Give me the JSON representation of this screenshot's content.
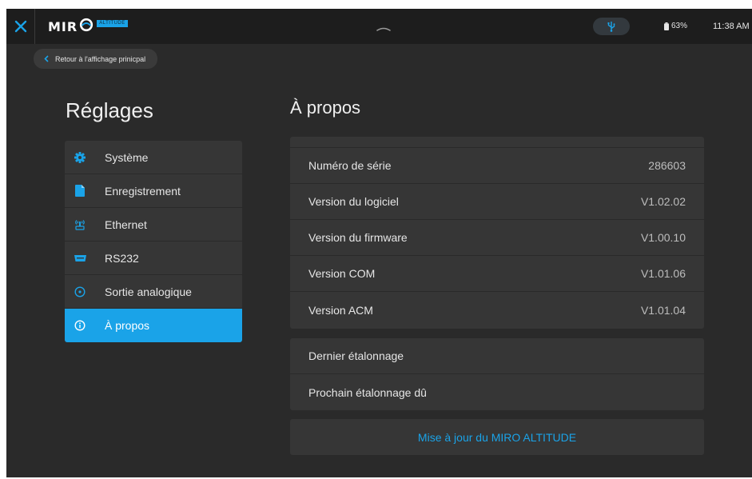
{
  "topbar": {
    "logo_text": "MIR",
    "logo_badge": "ALTITUDE",
    "battery": "63%",
    "time": "11:38 AM"
  },
  "back": {
    "label": "Retour à l'affichage prinicpal"
  },
  "sidebar": {
    "title": "Réglages",
    "items": [
      {
        "label": "Système",
        "icon": "gear-icon"
      },
      {
        "label": "Enregistrement",
        "icon": "file-icon"
      },
      {
        "label": "Ethernet",
        "icon": "ethernet-icon"
      },
      {
        "label": "RS232",
        "icon": "serial-port-icon"
      },
      {
        "label": "Sortie analogique",
        "icon": "analog-output-icon"
      },
      {
        "label": "À propos",
        "icon": "info-icon",
        "active": true
      }
    ]
  },
  "main": {
    "title": "À propos",
    "info_rows": [
      {
        "label": "Numéro de série",
        "value": "286603"
      },
      {
        "label": "Version du logiciel",
        "value": "V1.02.02"
      },
      {
        "label": "Version du firmware",
        "value": "V1.00.10"
      },
      {
        "label": "Version COM",
        "value": "V1.01.06"
      },
      {
        "label": "Version ACM",
        "value": "V1.01.04"
      }
    ],
    "calibration": {
      "last_label": "Dernier étalonnage",
      "next_label": "Prochain étalonnage dû"
    },
    "update_button": "Mise à jour du MIRO ALTITUDE"
  },
  "colors": {
    "accent": "#1aa3e8",
    "background": "#2a2a2a",
    "panel": "#363636",
    "topbar": "#1d1d1d"
  }
}
